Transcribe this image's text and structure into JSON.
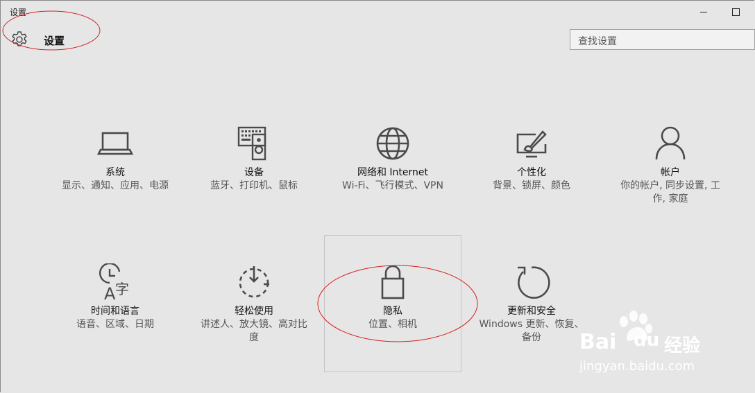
{
  "window": {
    "title": "设置"
  },
  "header": {
    "title": "设置",
    "gear_icon": "gear-icon"
  },
  "search": {
    "placeholder": "查找设置"
  },
  "tiles": [
    {
      "icon": "laptop-icon",
      "title": "系统",
      "desc": "显示、通知、应用、电源"
    },
    {
      "icon": "keyboard-speaker-icon",
      "title": "设备",
      "desc": "蓝牙、打印机、鼠标"
    },
    {
      "icon": "globe-icon",
      "title": "网络和 Internet",
      "desc": "Wi-Fi、飞行模式、VPN"
    },
    {
      "icon": "paint-brush-monitor-icon",
      "title": "个性化",
      "desc": "背景、锁屏、颜色"
    },
    {
      "icon": "person-icon",
      "title": "帐户",
      "desc": "你的帐户, 同步设置, 工作, 家庭"
    },
    {
      "icon": "clock-language-icon",
      "title": "时间和语言",
      "desc": "语音、区域、日期"
    },
    {
      "icon": "ease-of-access-icon",
      "title": "轻松使用",
      "desc": "讲述人、放大镜、高对比度"
    },
    {
      "icon": "lock-icon",
      "title": "隐私",
      "desc": "位置、相机"
    },
    {
      "icon": "refresh-icon",
      "title": "更新和安全",
      "desc": "Windows 更新、恢复、备份"
    }
  ],
  "watermark": {
    "brand_a": "Bai",
    "brand_b": "du",
    "brand_c": "经验",
    "url": "jingyan.baidu.com"
  },
  "colors": {
    "background": "#e6e6e6",
    "icon": "#4a4a4a",
    "annotation": "#d42020"
  }
}
